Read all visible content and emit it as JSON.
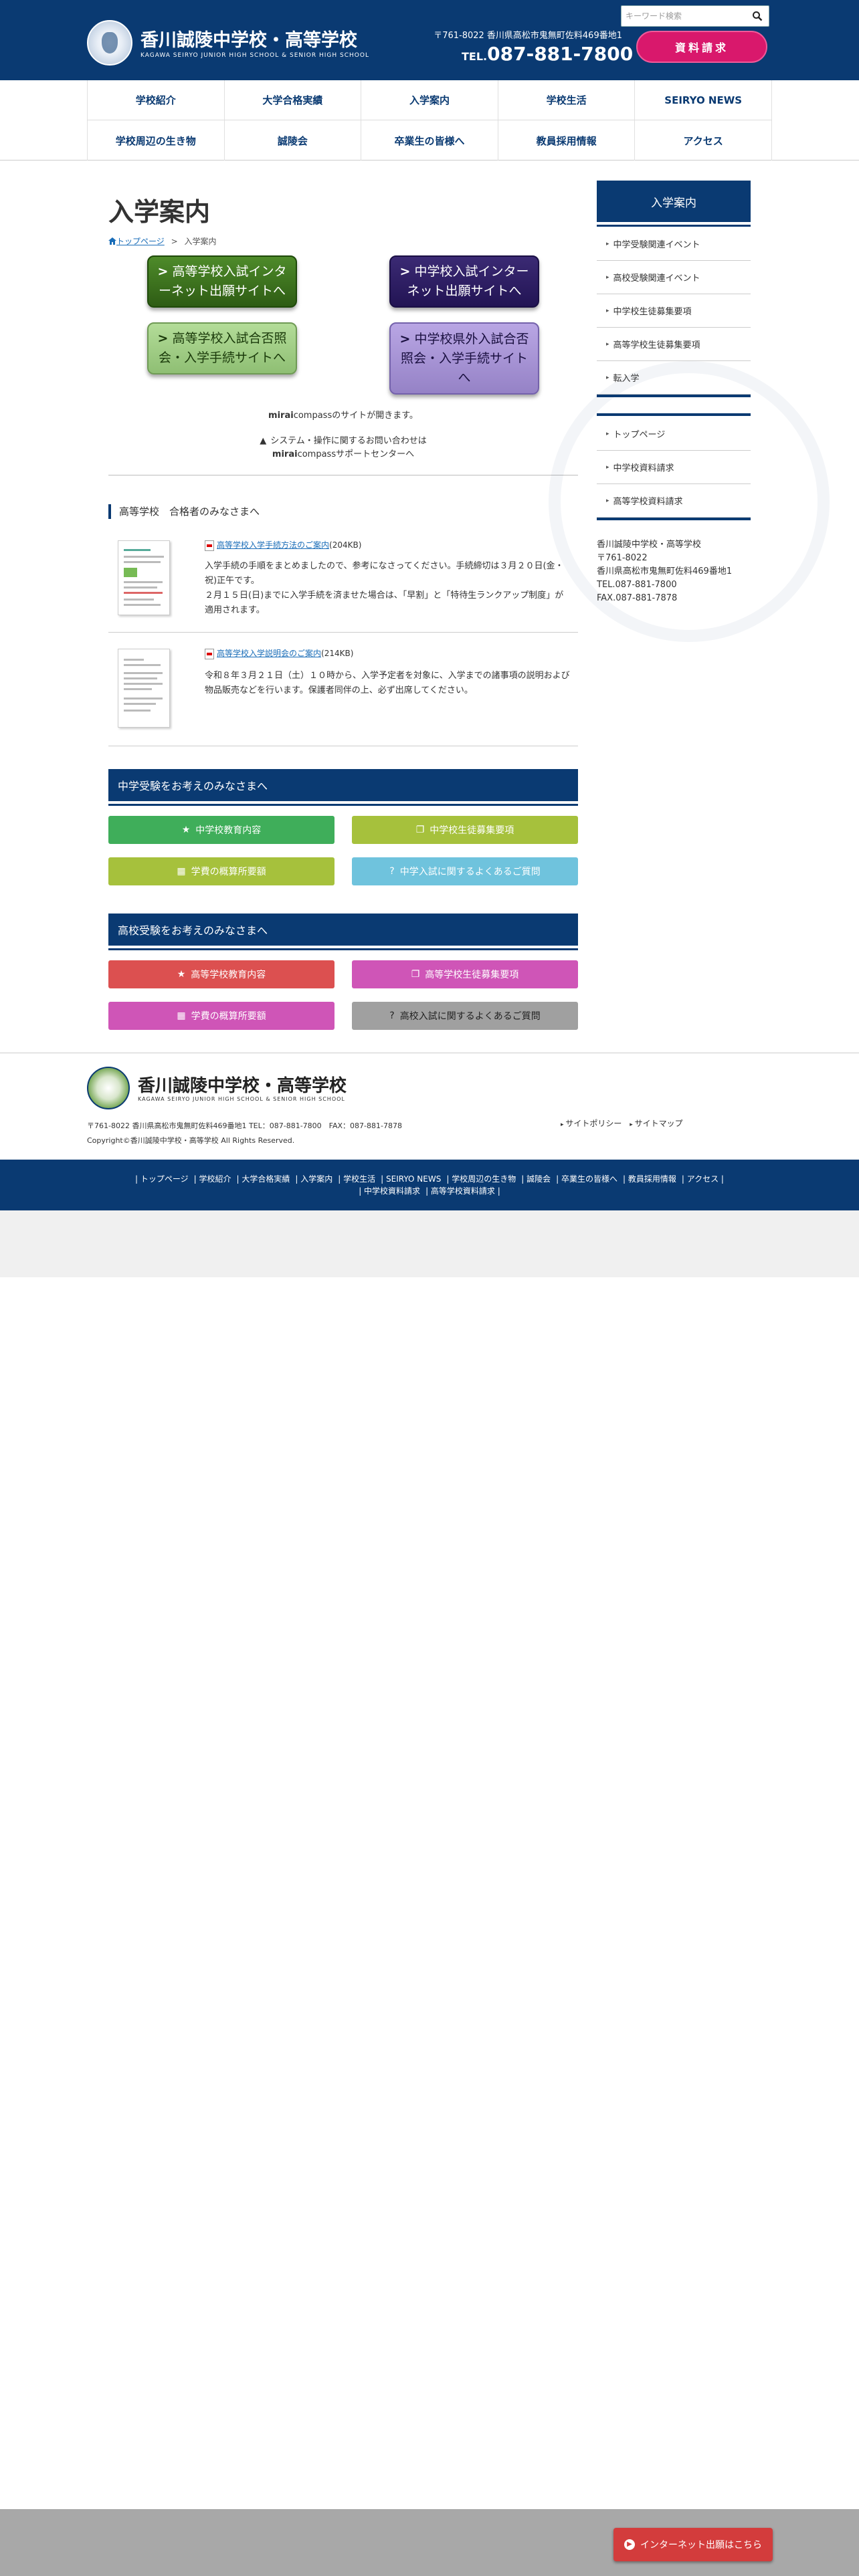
{
  "header": {
    "school_name": "香川誠陵中学校・高等学校",
    "school_name_en": "KAGAWA SEIRYO JUNIOR HIGH SCHOOL & SENIOR HIGH SCHOOL",
    "search_placeholder": "キーワード検索",
    "address": "〒761-8022 香川県高松市鬼無町佐料469番地1",
    "tel_prefix": "TEL.",
    "tel": "087-881-7800",
    "request_button": "資料請求"
  },
  "global_nav": {
    "row1": [
      "学校紹介",
      "大学合格実績",
      "入学案内",
      "学校生活",
      "SEIRYO NEWS"
    ],
    "row2": [
      "学校周辺の生き物",
      "誠陵会",
      "卒業生の皆様へ",
      "教員採用情報",
      "アクセス"
    ]
  },
  "page": {
    "title": "入学案内",
    "breadcrumb_home": "トップページ",
    "breadcrumb_sep": ">",
    "breadcrumb_current": "入学案内"
  },
  "big_buttons": {
    "high_net": "高等学校入試インターネット出願サイトへ",
    "jr_net": "中学校入試インターネット出願サイトへ",
    "high_result": "高等学校入試合否照会・入学手続サイトへ",
    "jr_outside": "中学校県外入試合否照会・入学手続サイトへ"
  },
  "mirai": {
    "note1_bold": "mirai",
    "note1_rest": "compassのサイトが開きます。",
    "note2_line1": "システム・操作に関するお問い合わせは",
    "note2_line2_bold": "mirai",
    "note2_line2_rest": "compassサポートセンターへ"
  },
  "section_high_passed": {
    "heading": "高等学校　合格者のみなさまへ",
    "docs": [
      {
        "link": "高等学校入学手続方法のご案内",
        "size": "(204KB)",
        "desc": "入学手続の手順をまとめましたので、参考になさってください。手続締切は３月２０日(金・祝)正午です。\n２月１５日(日)までに入学手続を済ませた場合は、「早割」と「特待生ランクアップ制度」が適用されます。"
      },
      {
        "link": "高等学校入学説明会のご案内",
        "size": "(214KB)",
        "desc": "令和８年３月２１日（土）１０時から、入学予定者を対象に、入学までの諸事項の説明および物品販売などを行います。保護者同伴の上、必ず出席してください。"
      }
    ]
  },
  "jr_section": {
    "heading": "中学受験をお考えのみなさまへ",
    "buttons": [
      "中学校教育内容",
      "中学校生徒募集要項",
      "学費の概算所要額",
      "中学入試に関するよくあるご質問"
    ]
  },
  "high_section": {
    "heading": "高校受験をお考えのみなさまへ",
    "buttons": [
      "高等学校教育内容",
      "高等学校生徒募集要項",
      "学費の概算所要額",
      "高校入試に関するよくあるご質問"
    ]
  },
  "sidebar": {
    "heading": "入学案内",
    "items": [
      "中学受験関連イベント",
      "高校受験関連イベント",
      "中学校生徒募集要項",
      "高等学校生徒募集要項",
      "転入学"
    ],
    "links": [
      "トップページ",
      "中学校資料請求",
      "高等学校資料請求"
    ],
    "address_lines": [
      "香川誠陵中学校・高等学校",
      "〒761-8022",
      "香川県高松市鬼無町佐料469番地1",
      "TEL.087-881-7800",
      "FAX.087-881-7878"
    ]
  },
  "footer": {
    "school_name": "香川誠陵中学校・高等学校",
    "school_name_en": "KAGAWA SEIRYO JUNIOR HIGH SCHOOL & SENIOR HIGH SCHOOL",
    "address": "〒761-8022 香川県高松市鬼無町佐料469番地1 TEL：087-881-7800　FAX：087-881-7878",
    "copyright": "Copyright©香川誠陵中学校・高等学校 All Rights Reserved.",
    "links": [
      "サイトポリシー",
      "サイトマップ"
    ],
    "nav_row1": [
      "トップページ",
      "学校紹介",
      "大学合格実績",
      "入学案内",
      "学校生活",
      "SEIRYO NEWS",
      "学校周辺の生き物",
      "誠陵会",
      "卒業生の皆様へ",
      "教員採用情報",
      "アクセス"
    ],
    "nav_row2": [
      "中学校資料請求",
      "高等学校資料請求"
    ]
  },
  "floating": {
    "net_button": "インターネット出願はこちら"
  },
  "colors": {
    "navy": "#0a3a72",
    "request_pink": "#d9186c",
    "jr_green": "#3fae5a",
    "jr_lime": "#a6c13c",
    "jr_sky": "#6fc3dd",
    "high_red": "#dc5050",
    "high_magenta": "#cf55b7",
    "high_gray": "#a0a0a0"
  },
  "icons": [
    "search-icon",
    "chevron-right-icon",
    "warning-icon",
    "star-icon",
    "copy-icon",
    "calculator-icon",
    "question-icon",
    "home-icon",
    "pdf-icon",
    "arrow-right-icon"
  ]
}
